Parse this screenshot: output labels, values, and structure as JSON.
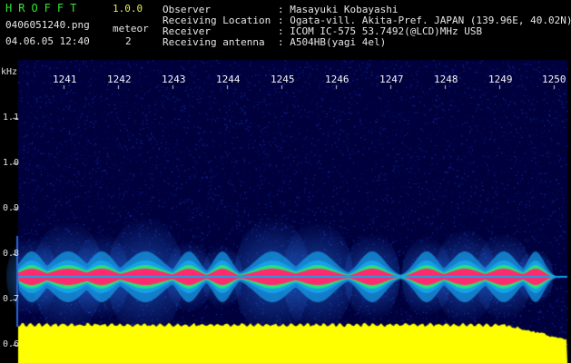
{
  "app": {
    "name": "HROFFT",
    "version": "1.0.0"
  },
  "file": {
    "name": "0406051240.png",
    "datetime": "04.06.05 12:40"
  },
  "meteor": {
    "label": "meteor",
    "count": "2"
  },
  "station": [
    {
      "key": "Observer",
      "value": ": Masayuki Kobayashi"
    },
    {
      "key": "Receiving Location",
      "value": ": Ogata-vill. Akita-Pref. JAPAN (139.96E, 40.02N)"
    },
    {
      "key": "Receiver",
      "value": ": ICOM IC-575 53.7492(@LCD)MHz USB"
    },
    {
      "key": "Receiving antenna",
      "value": ": A504HB(yagi 4el)"
    }
  ],
  "spectrogram": {
    "freq_unit": "kHz",
    "freq_ticks": [
      "1.1",
      "1.0",
      "0.9",
      "0.8",
      "0.7",
      "0.6"
    ],
    "time_ticks": [
      "1241",
      "1242",
      "1243",
      "1244",
      "1245",
      "1246",
      "1247",
      "1248",
      "1249",
      "1250"
    ],
    "colors": {
      "background": "#00003c",
      "noise": "#0a1e8c",
      "signal_high": "#ff2a6e",
      "signal_mid": "#27e07a",
      "signal_low": "#15a0e8",
      "power": "#ffff00"
    }
  }
}
